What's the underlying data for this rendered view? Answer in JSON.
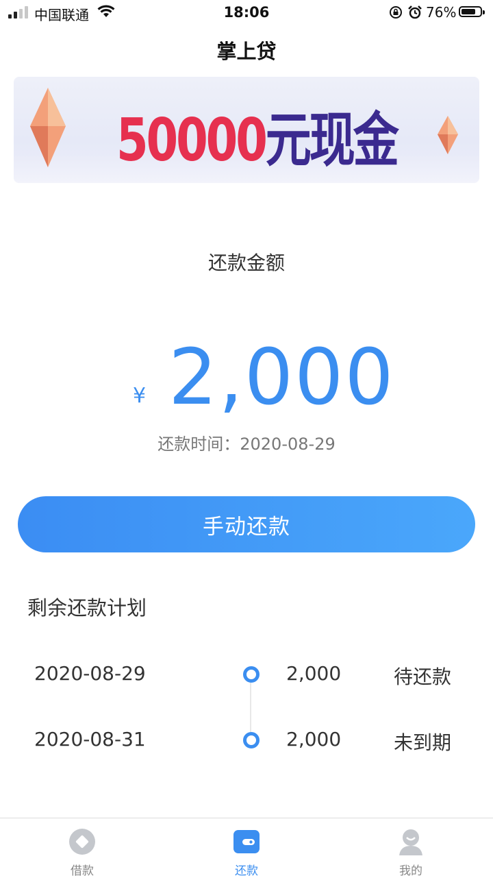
{
  "status_bar": {
    "carrier": "中国联通",
    "time": "18:06",
    "battery_percent": "76%",
    "battery_level": 0.76
  },
  "nav": {
    "title": "掌上贷"
  },
  "banner": {
    "amount_text": "50000",
    "suffix_text": "元现金"
  },
  "repayment": {
    "label": "还款金额",
    "currency_symbol": "¥",
    "amount": "2,000",
    "due_label": "还款时间：",
    "due_date": "2020-08-29"
  },
  "pay_button": {
    "label": "手动还款"
  },
  "plan": {
    "title": "剩余还款计划",
    "rows": [
      {
        "date": "2020-08-29",
        "amount": "2,000",
        "status": "待还款"
      },
      {
        "date": "2020-08-31",
        "amount": "2,000",
        "status": "未到期"
      }
    ]
  },
  "tabs": [
    {
      "label": "借款",
      "icon": "loan-icon",
      "active": false
    },
    {
      "label": "还款",
      "icon": "wallet-icon",
      "active": true
    },
    {
      "label": "我的",
      "icon": "profile-icon",
      "active": false
    }
  ],
  "colors": {
    "accent": "#3b8ef0",
    "banner_number": "#e6304f",
    "banner_text": "#3b2a8f",
    "inactive_tab": "#c4c7cc"
  }
}
